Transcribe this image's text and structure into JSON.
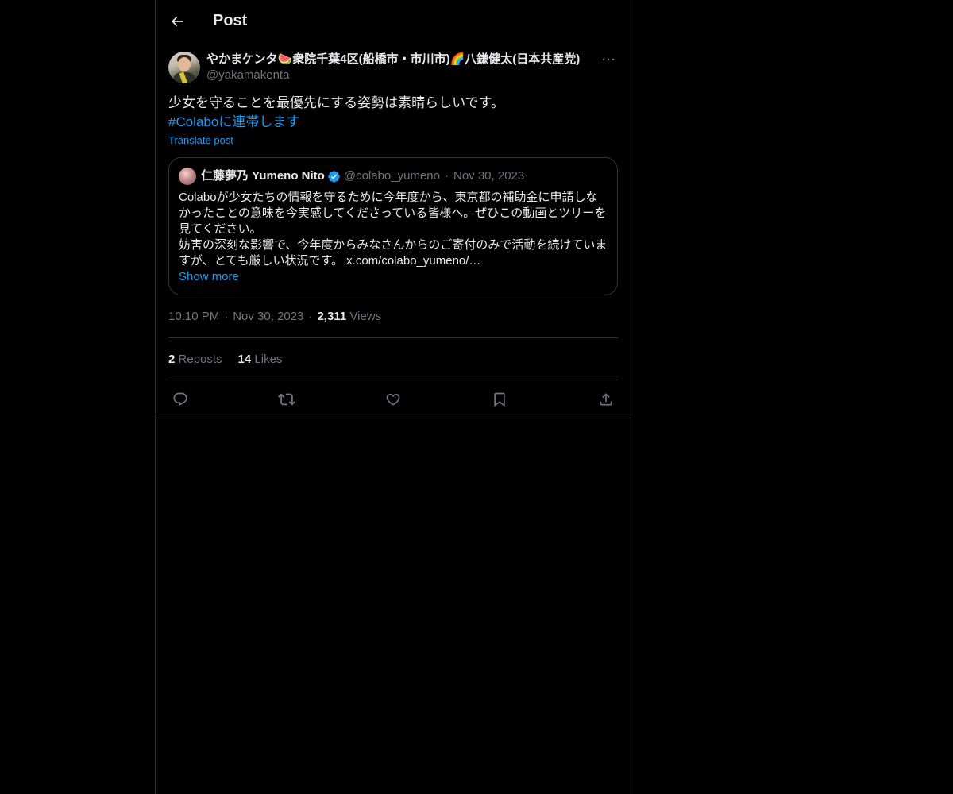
{
  "header": {
    "title": "Post"
  },
  "tweet": {
    "display_name": "やかまケンタ🍉衆院千葉4区(船橋市・市川市)🌈八鎌健太(日本共産党)",
    "handle": "@yakamakenta",
    "more_label": "···",
    "text_line1": "少女を守ることを最優先にする姿勢は素晴らしいです。",
    "hashtag": "#Colaboに連帯します",
    "translate_label": "Translate post",
    "quote": {
      "name": "仁藤夢乃 Yumeno Nito",
      "handle": "@colabo_yumeno",
      "dot": "·",
      "date": "Nov 30, 2023",
      "text": "Colaboが少女たちの情報を守るために今年度から、東京都の補助金に申請しなかったことの意味を今実感してくださっている皆様へ。ぜひこの動画とツリーを見てください。\n妨害の深刻な影響で、今年度からみなさんからのご寄付のみで活動を続けていますが、とても厳しい状況です。 x.com/colabo_yumeno/…",
      "show_more": "Show more"
    },
    "time": "10:10 PM",
    "date": "Nov 30, 2023",
    "dot": "·",
    "views_count": "2,311",
    "views_label": "Views",
    "reposts_count": "2",
    "reposts_label": "Reposts",
    "likes_count": "14",
    "likes_label": "Likes"
  },
  "icons": {
    "back": "arrow-left-icon",
    "reply": "reply-icon",
    "repost": "repost-icon",
    "like": "heart-icon",
    "bookmark": "bookmark-icon",
    "share": "share-icon",
    "verified": "verified-badge-icon"
  },
  "colors": {
    "background": "#000000",
    "text": "#e7e9ea",
    "muted": "#71767b",
    "accent": "#1d9bf0",
    "border": "#2f3336"
  }
}
